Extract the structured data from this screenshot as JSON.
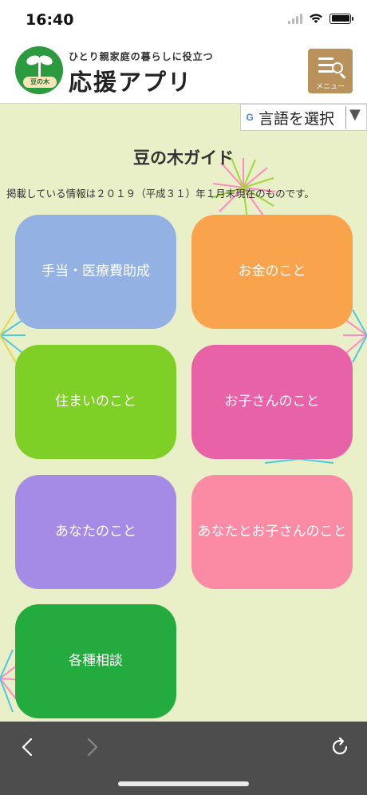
{
  "status": {
    "time": "16:40"
  },
  "header": {
    "subtitle": "ひとり親家庭の暮らしに役立つ",
    "title": "応援アプリ",
    "logo_text": "豆の木",
    "menu_label": "メニュー"
  },
  "language": {
    "label": "言語を選択",
    "arrow": "▼"
  },
  "content": {
    "title": "豆の木ガイド",
    "note": "掲載している情報は２０１９（平成３１）年１月末現在のものです。"
  },
  "tiles": [
    {
      "label": "手当・医療費助成",
      "color": "#93b1e2"
    },
    {
      "label": "お金のこと",
      "color": "#f9a44d"
    },
    {
      "label": "住まいのこと",
      "color": "#7ed026"
    },
    {
      "label": "お子さんのこと",
      "color": "#e862a8"
    },
    {
      "label": "あなたのこと",
      "color": "#a68be6"
    },
    {
      "label": "あなたとお子さんのこと",
      "color": "#fb8ba5"
    },
    {
      "label": "各種相談",
      "color": "#23ab3d"
    }
  ],
  "toolbar": {
    "back_icon": "chevron-left",
    "forward_icon": "chevron-right",
    "reload_icon": "reload"
  }
}
